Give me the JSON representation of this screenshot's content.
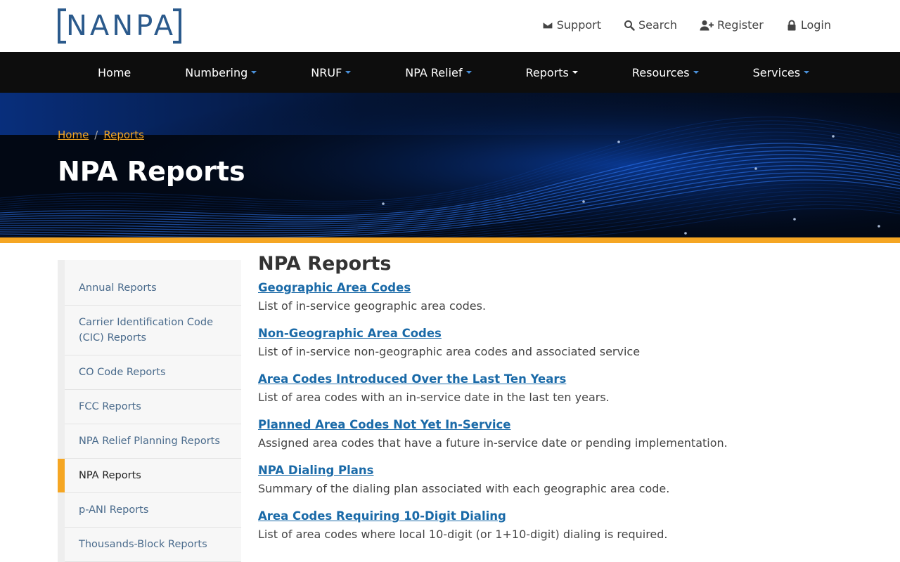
{
  "logo": {
    "text": "NANPA"
  },
  "utility": [
    {
      "label": "Support",
      "icon": "envelope-icon"
    },
    {
      "label": "Search",
      "icon": "search-icon"
    },
    {
      "label": "Register",
      "icon": "user-plus-icon"
    },
    {
      "label": "Login",
      "icon": "lock-icon"
    }
  ],
  "nav": [
    {
      "label": "Home"
    },
    {
      "label": "Numbering"
    },
    {
      "label": "NRUF"
    },
    {
      "label": "NPA Relief"
    },
    {
      "label": "Reports"
    },
    {
      "label": "Resources"
    },
    {
      "label": "Services"
    }
  ],
  "breadcrumb": {
    "home": "Home",
    "reports": "Reports",
    "separator": "/"
  },
  "hero": {
    "title": "NPA Reports"
  },
  "sidebar": {
    "items": [
      {
        "label": "Annual Reports"
      },
      {
        "label": "Carrier Identification Code (CIC) Reports"
      },
      {
        "label": "CO Code Reports"
      },
      {
        "label": "FCC Reports"
      },
      {
        "label": "NPA Relief Planning Reports"
      },
      {
        "label": "NPA Reports"
      },
      {
        "label": "p-ANI Reports"
      },
      {
        "label": "Thousands-Block Reports"
      }
    ]
  },
  "main": {
    "title": "NPA Reports",
    "reports": [
      {
        "title": "Geographic Area Codes",
        "desc": "List of in-service geographic area codes."
      },
      {
        "title": "Non-Geographic Area Codes",
        "desc": "List of in-service non-geographic area codes and associated service"
      },
      {
        "title": "Area Codes Introduced Over the Last Ten Years",
        "desc": "List of area codes with an in-service date in the last ten years."
      },
      {
        "title": "Planned Area Codes Not Yet In-Service",
        "desc": "Assigned area codes that have a future in-service date or pending implementation."
      },
      {
        "title": "NPA Dialing Plans",
        "desc": "Summary of the dialing plan associated with each geographic area code."
      },
      {
        "title": "Area Codes Requiring 10-Digit Dialing",
        "desc": "List of area codes where local 10-digit (or 1+10-digit) dialing is required."
      }
    ]
  },
  "colors": {
    "accent": "#f5a623",
    "link": "#1a6aa8",
    "nav_bg": "#0d0d0d",
    "logo": "#2b5a8c"
  }
}
